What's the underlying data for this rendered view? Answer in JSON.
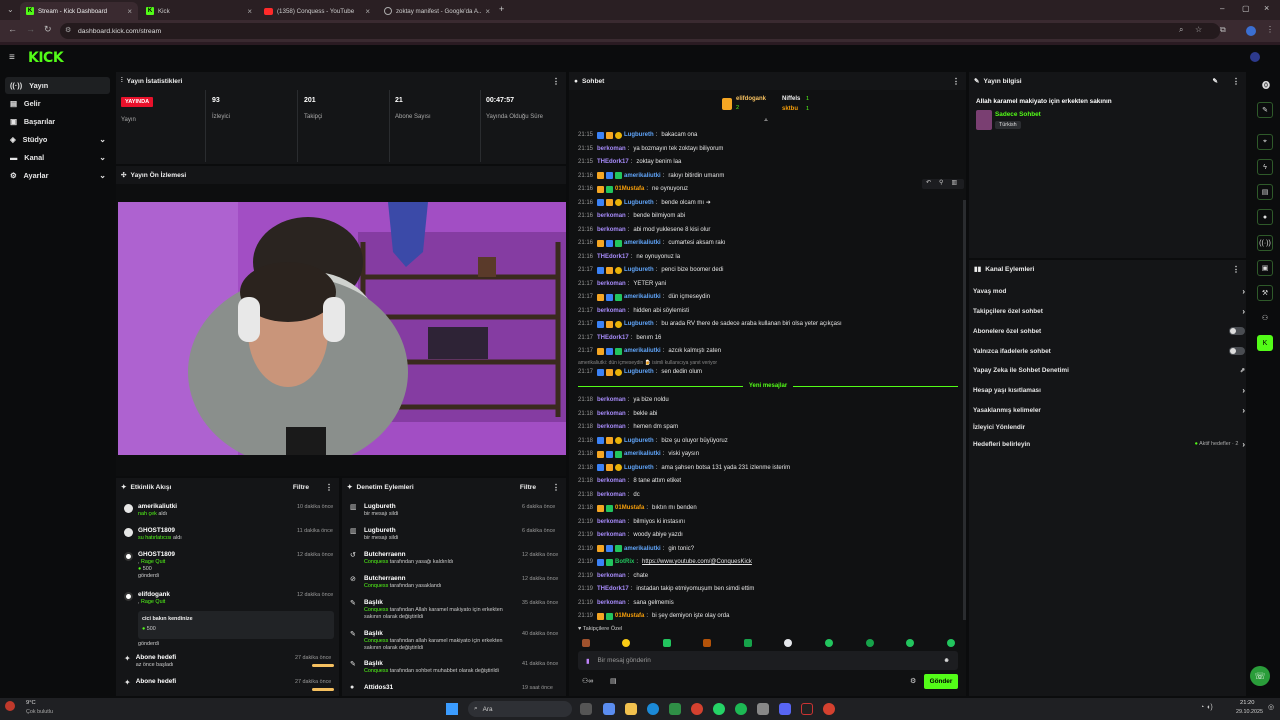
{
  "browser": {
    "tabs": [
      {
        "title": "Stream - Kick Dashboard"
      },
      {
        "title": "Kick"
      },
      {
        "title": "(1358) Conquess - YouTube"
      },
      {
        "title": "zoktay manifest - Google'da A..."
      }
    ],
    "url": "dashboard.kick.com/stream"
  },
  "app": {
    "logo": "KICK"
  },
  "sidebar": {
    "items": [
      {
        "label": "Yayın"
      },
      {
        "label": "Gelir"
      },
      {
        "label": "Başarılar"
      },
      {
        "label": "Stüdyo"
      },
      {
        "label": "Kanal"
      },
      {
        "label": "Ayarlar"
      }
    ]
  },
  "stats": {
    "title": "Yayın İstatistikleri",
    "live_badge": "YAYINDA",
    "live_label": "Yayın",
    "items": [
      {
        "value": "93",
        "label": "İzleyici"
      },
      {
        "value": "201",
        "label": "Takipçi"
      },
      {
        "value": "21",
        "label": "Abone Sayısı"
      },
      {
        "value": "00:47:57",
        "label": "Yayında Olduğu Süre"
      }
    ]
  },
  "preview": {
    "title": "Yayın Ön İzlemesi"
  },
  "activity": {
    "title": "Etkinlik Akışı",
    "filter": "Filtre",
    "items": [
      {
        "name": "amerikaliutki",
        "sub_green": "nah çek",
        "sub": " aldı",
        "time": ""
      },
      {
        "name": "GHOST1809",
        "sub_green": "su hatırlatıcısı",
        "sub": " aldı",
        "time": "11 dakika önce"
      },
      {
        "name": "GHOST1809",
        "sub_green": "Rage Quit",
        "amount": "500",
        "sub": "gönderdi",
        "time": "12 dakika önce"
      },
      {
        "name": "elifdogank",
        "sub_green": "Rage Quit",
        "note": "cici bakın kendinize",
        "amount": "500",
        "sub": "gönderdi",
        "time": "12 dakika önce"
      },
      {
        "name": "Abone hedefi",
        "sub": "az önce başladı",
        "time": "27 dakika önce"
      },
      {
        "name": "Abone hedefi",
        "sub": "",
        "time": "27 dakika önce"
      }
    ],
    "first_time": "10 dakika önce"
  },
  "moderation": {
    "title": "Denetim Eylemleri",
    "filter": "Filtre",
    "items": [
      {
        "name": "Lugbureth",
        "sub": "bir mesajı sildi",
        "time": "6 dakika önce"
      },
      {
        "name": "Lugbureth",
        "sub": "bir mesajı sildi",
        "time": "6 dakika önce"
      },
      {
        "name": "Butcherraenn",
        "actor": "Conquess",
        "sub": " tarafından yasağı kaldırıldı",
        "time": "12 dakika önce"
      },
      {
        "name": "Butcherraenn",
        "actor": "Conquess",
        "sub": " tarafından yasaklandı",
        "time": "12 dakika önce"
      },
      {
        "name": "Başlık",
        "actor": "Conquess",
        "sub": " tarafından Allah karamel makiyato için erkekten sakının olarak değiştirildi",
        "time": "35 dakika önce"
      },
      {
        "name": "Başlık",
        "actor": "Conquess",
        "sub": " tarafından allah karamel makiyato için erkekten sakının olarak değiştirildi",
        "time": "40 dakika önce"
      },
      {
        "name": "Başlık",
        "actor": "Conquess",
        "sub": " tarafından sohbet muhabbet olarak değiştirildi",
        "time": "41 dakika önce"
      },
      {
        "name": "Attidos31",
        "sub": "",
        "time": "19 saat önce"
      }
    ]
  },
  "chat": {
    "title": "Sohbet",
    "top_users": [
      {
        "name": "elifdogank",
        "count": "2"
      },
      {
        "name": "Niffels",
        "count": "1"
      },
      {
        "name": "sktbu",
        "count": "1"
      }
    ],
    "messages": [
      {
        "t": "21:15",
        "u": "Lugbureth",
        "c": "#60a5fa",
        "m": "bakacam ona"
      },
      {
        "t": "21:15",
        "u": "berkoman",
        "c": "#a78bfa",
        "m": "ya bozmayın tek zoktayı biliyorum"
      },
      {
        "t": "21:15",
        "u": "THEdork17",
        "c": "#a78bfa",
        "m": "zoktay benim laa"
      },
      {
        "t": "21:16",
        "u": "amerikaliutki",
        "c": "#60a5fa",
        "m": "rakıyı bitirdin umarım"
      },
      {
        "t": "21:16",
        "u": "01Mustafa",
        "c": "#f59e0b",
        "m": "ne oynuyoruz"
      },
      {
        "t": "21:16",
        "u": "Lugbureth",
        "c": "#60a5fa",
        "m": "bende olcam mı ➜"
      },
      {
        "t": "21:16",
        "u": "berkoman",
        "c": "#a78bfa",
        "m": "bende bilmiyom abi"
      },
      {
        "t": "21:16",
        "u": "berkoman",
        "c": "#a78bfa",
        "m": "abi mod yuklesene 8 kisi olur"
      },
      {
        "t": "21:16",
        "u": "amerikaliutki",
        "c": "#60a5fa",
        "m": "cumartesi aksam rakı"
      },
      {
        "t": "21:16",
        "u": "THEdork17",
        "c": "#a78bfa",
        "m": "ne oynuyonuz la"
      },
      {
        "t": "21:17",
        "u": "Lugbureth",
        "c": "#60a5fa",
        "m": "penci bize boomer dedi"
      },
      {
        "t": "21:17",
        "u": "berkoman",
        "c": "#a78bfa",
        "m": "YETER yani"
      },
      {
        "t": "21:17",
        "u": "amerikaliutki",
        "c": "#60a5fa",
        "m": "dün içmeseydin"
      },
      {
        "t": "21:17",
        "u": "berkoman",
        "c": "#a78bfa",
        "m": "hidden abi söylemisti"
      },
      {
        "t": "21:17",
        "u": "Lugbureth",
        "c": "#60a5fa",
        "m": "bu arada RV there de sadece araba kullanan biri olsa yeter açıkçası"
      },
      {
        "t": "21:17",
        "u": "THEdork17",
        "c": "#a78bfa",
        "m": "benım 16"
      },
      {
        "t": "21:17",
        "u": "amerikaliutki",
        "c": "#60a5fa",
        "m": "azcık kalmıştı zaten"
      }
    ],
    "reply_hint": "amerikaliutki: dün içmeseydin 🍺 isimli kullanıcıya yanıt veriyor",
    "reply_msg": {
      "t": "21:17",
      "u": "Lugbureth",
      "c": "#60a5fa",
      "m": "sen dedin olum"
    },
    "new_messages": "Yeni mesajlar",
    "messages2": [
      {
        "t": "21:18",
        "u": "berkoman",
        "c": "#a78bfa",
        "m": "ya bize noldu"
      },
      {
        "t": "21:18",
        "u": "berkoman",
        "c": "#a78bfa",
        "m": "bekle abi"
      },
      {
        "t": "21:18",
        "u": "berkoman",
        "c": "#a78bfa",
        "m": "hemen dm spam"
      },
      {
        "t": "21:18",
        "u": "Lugbureth",
        "c": "#60a5fa",
        "m": "bize şu oluyor büyüyoruz"
      },
      {
        "t": "21:18",
        "u": "amerikaliutki",
        "c": "#60a5fa",
        "m": "viski yaysın"
      },
      {
        "t": "21:18",
        "u": "Lugbureth",
        "c": "#60a5fa",
        "m": "ama şahsen botsa 131 yada 231 izlenme isterim"
      },
      {
        "t": "21:18",
        "u": "berkoman",
        "c": "#a78bfa",
        "m": "8 tane attım etiket"
      },
      {
        "t": "21:18",
        "u": "berkoman",
        "c": "#a78bfa",
        "m": "dc"
      },
      {
        "t": "21:18",
        "u": "01Mustafa",
        "c": "#f59e0b",
        "m": "bıktın mı benden"
      },
      {
        "t": "21:19",
        "u": "berkoman",
        "c": "#a78bfa",
        "m": "bilmiyos ki instasını"
      },
      {
        "t": "21:19",
        "u": "berkoman",
        "c": "#a78bfa",
        "m": "woody abiye yazdı"
      },
      {
        "t": "21:19",
        "u": "amerikaliutki",
        "c": "#60a5fa",
        "m": "gin tonic?"
      },
      {
        "t": "21:19",
        "u": "BotRix",
        "c": "#22c55e",
        "m": "https://www.youtube.com/@ConquesKick"
      },
      {
        "t": "21:19",
        "u": "berkoman",
        "c": "#a78bfa",
        "m": "chate"
      },
      {
        "t": "21:19",
        "u": "THEdork17",
        "c": "#a78bfa",
        "m": "instadan takip etmiyomuşum ben simdi ettim"
      },
      {
        "t": "21:19",
        "u": "berkoman",
        "c": "#a78bfa",
        "m": "sana gelmemis"
      },
      {
        "t": "21:19",
        "u": "01Mustafa",
        "c": "#f59e0b",
        "m": "bi şey demiyon işte olay orda"
      }
    ],
    "followers_only": "Takipçilere Özel",
    "input_placeholder": "Bir mesaj gönderin",
    "send": "Gönder"
  },
  "stream_info": {
    "title": "Yayın bilgisi",
    "stream_title": "Allah karamel makiyato için erkekten sakının",
    "category": "Sadece Sohbet",
    "tag": "Türkish"
  },
  "channel_actions": {
    "title": "Kanal Eylemleri",
    "items": [
      {
        "label": "Yavaş mod",
        "kind": "arrow"
      },
      {
        "label": "Takipçilere özel sohbet",
        "kind": "arrow"
      },
      {
        "label": "Abonelere özel sohbet",
        "kind": "toggle"
      },
      {
        "label": "Yalnızca ifadelerle sohbet",
        "kind": "toggle"
      },
      {
        "label": "Yapay Zeka ile Sohbet Denetimi",
        "kind": "ext"
      },
      {
        "label": "Hesap yaşı kısıtlaması",
        "kind": "arrow"
      },
      {
        "label": "Yasaklanmış kelimeler",
        "kind": "arrow"
      },
      {
        "label": "İzleyici Yönlendir",
        "kind": "none"
      },
      {
        "label": "Hedefleri belirleyin",
        "kind": "goals"
      }
    ],
    "goals_label": "Aktif hedefler · 2"
  },
  "taskbar": {
    "weather_temp": "9°C",
    "weather_desc": "Çok bulutlu",
    "search": "Ara",
    "time": "21:20",
    "date": "29.10.2025"
  },
  "colors": {
    "accent": "#53fc18",
    "live": "#e9112b",
    "panel": "#141517"
  }
}
